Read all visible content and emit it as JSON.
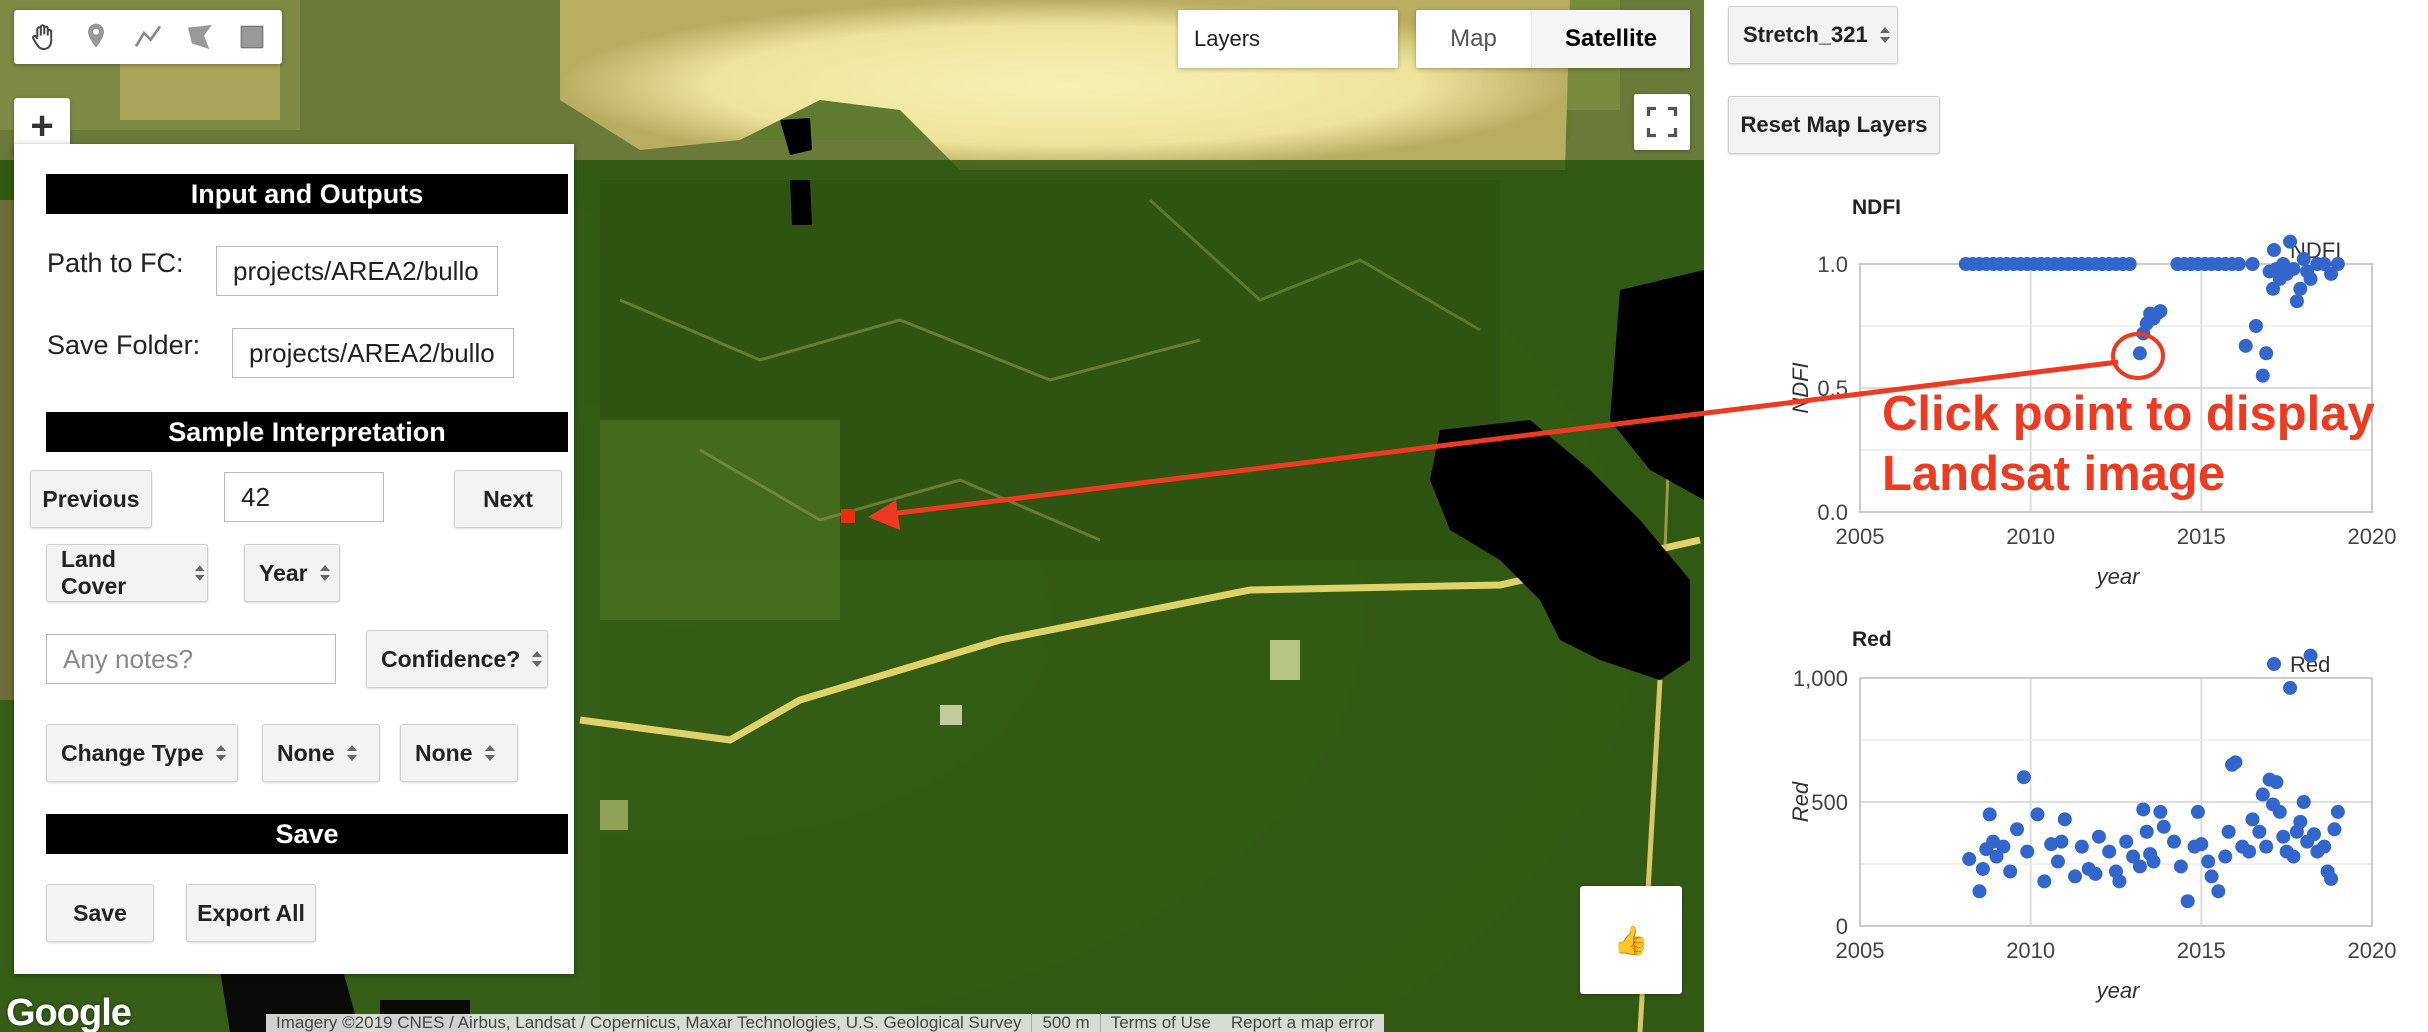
{
  "map": {
    "layers_label": "Layers",
    "map_type": {
      "map_label": "Map",
      "satellite_label": "Satellite",
      "selected": "Satellite"
    },
    "zoom_plus_label": "+",
    "google_logo": "Google",
    "attribution": "Imagery ©2019 CNES / Airbus, Landsat / Copernicus, Maxar Technologies, U.S. Geological Survey",
    "scale_label": "500 m",
    "terms_label": "Terms of Use",
    "report_label": "Report a map error",
    "thumb_icon": "👍",
    "toolbar_icons": [
      "hand-icon",
      "marker-icon",
      "line-icon",
      "polygon-icon",
      "rectangle-icon"
    ]
  },
  "panel": {
    "io_header": "Input and Outputs",
    "path_label": "Path to FC:",
    "path_value": "projects/AREA2/bullo",
    "folder_label": "Save Folder:",
    "folder_value": "projects/AREA2/bullo",
    "sample_header": "Sample Interpretation",
    "previous_label": "Previous",
    "sample_index": "42",
    "next_label": "Next",
    "land_cover_label": "Land Cover",
    "year_label": "Year",
    "notes_placeholder": "Any notes?",
    "confidence_label": "Confidence?",
    "change_type_label": "Change Type",
    "none1_label": "None",
    "none2_label": "None",
    "save_header": "Save",
    "save_label": "Save",
    "export_label": "Export All"
  },
  "sidebar": {
    "stretch_label": "Stretch_321",
    "reset_label": "Reset Map Layers"
  },
  "annotation": {
    "line1": "Click point to display",
    "line2": "Landsat image",
    "color": "#ee3a20"
  },
  "chart_data": [
    {
      "type": "scatter",
      "title": "NDFI",
      "xlabel": "year",
      "ylabel": "NDFI",
      "legend": "NDFI",
      "legend_position": "top-right",
      "xlim": [
        2005,
        2020
      ],
      "ylim": [
        0,
        1
      ],
      "xticks": [
        "2005",
        "2010",
        "2015",
        "2020"
      ],
      "yticks": [
        "0.0",
        "0.5",
        "1.0"
      ],
      "color": "#3366cc",
      "grid": true,
      "points": [
        [
          2008.1,
          1.0
        ],
        [
          2008.3,
          1.0
        ],
        [
          2008.5,
          1.0
        ],
        [
          2008.7,
          1.0
        ],
        [
          2008.9,
          1.0
        ],
        [
          2009.1,
          1.0
        ],
        [
          2009.3,
          1.0
        ],
        [
          2009.5,
          1.0
        ],
        [
          2009.7,
          1.0
        ],
        [
          2009.9,
          1.0
        ],
        [
          2010.1,
          1.0
        ],
        [
          2010.3,
          1.0
        ],
        [
          2010.5,
          1.0
        ],
        [
          2010.7,
          1.0
        ],
        [
          2010.9,
          1.0
        ],
        [
          2011.1,
          1.0
        ],
        [
          2011.3,
          1.0
        ],
        [
          2011.5,
          1.0
        ],
        [
          2011.7,
          1.0
        ],
        [
          2011.9,
          1.0
        ],
        [
          2012.1,
          1.0
        ],
        [
          2012.3,
          1.0
        ],
        [
          2012.5,
          1.0
        ],
        [
          2012.7,
          1.0
        ],
        [
          2012.9,
          1.0
        ],
        [
          2013.2,
          0.64
        ],
        [
          2013.3,
          0.72
        ],
        [
          2013.4,
          0.76
        ],
        [
          2013.5,
          0.8
        ],
        [
          2013.6,
          0.78
        ],
        [
          2013.7,
          0.8
        ],
        [
          2013.8,
          0.81
        ],
        [
          2014.3,
          1.0
        ],
        [
          2014.5,
          1.0
        ],
        [
          2014.7,
          1.0
        ],
        [
          2014.9,
          1.0
        ],
        [
          2015.1,
          1.0
        ],
        [
          2015.3,
          1.0
        ],
        [
          2015.5,
          1.0
        ],
        [
          2015.7,
          1.0
        ],
        [
          2015.9,
          1.0
        ],
        [
          2016.1,
          1.0
        ],
        [
          2016.3,
          0.67
        ],
        [
          2016.5,
          1.0
        ],
        [
          2016.6,
          0.75
        ],
        [
          2016.8,
          0.55
        ],
        [
          2016.9,
          0.64
        ],
        [
          2017.0,
          0.97
        ],
        [
          2017.1,
          0.9
        ],
        [
          2017.2,
          0.98
        ],
        [
          2017.3,
          0.94
        ],
        [
          2017.4,
          1.0
        ],
        [
          2017.5,
          0.96
        ],
        [
          2017.6,
          1.09
        ],
        [
          2017.7,
          0.98
        ],
        [
          2017.8,
          0.85
        ],
        [
          2017.9,
          0.9
        ],
        [
          2018.0,
          1.02
        ],
        [
          2018.1,
          0.97
        ],
        [
          2018.2,
          0.94
        ],
        [
          2018.4,
          1.0
        ],
        [
          2018.6,
          1.0
        ],
        [
          2018.8,
          0.96
        ],
        [
          2019.0,
          1.0
        ]
      ],
      "highlight": [
        2013.2,
        0.64
      ]
    },
    {
      "type": "scatter",
      "title": "Red",
      "xlabel": "year",
      "ylabel": "Red",
      "legend": "Red",
      "legend_position": "top-right",
      "xlim": [
        2005,
        2020
      ],
      "ylim": [
        0,
        1000
      ],
      "xticks": [
        "2005",
        "2010",
        "2015",
        "2020"
      ],
      "yticks": [
        "0",
        "500",
        "1,000"
      ],
      "color": "#3366cc",
      "grid": true,
      "points": [
        [
          2008.2,
          270
        ],
        [
          2008.5,
          140
        ],
        [
          2008.6,
          230
        ],
        [
          2008.7,
          310
        ],
        [
          2008.8,
          450
        ],
        [
          2008.9,
          340
        ],
        [
          2009.0,
          280
        ],
        [
          2009.2,
          320
        ],
        [
          2009.4,
          220
        ],
        [
          2009.6,
          390
        ],
        [
          2009.8,
          600
        ],
        [
          2009.9,
          300
        ],
        [
          2010.2,
          450
        ],
        [
          2010.4,
          180
        ],
        [
          2010.6,
          330
        ],
        [
          2010.8,
          260
        ],
        [
          2010.9,
          340
        ],
        [
          2011.0,
          430
        ],
        [
          2011.3,
          200
        ],
        [
          2011.5,
          320
        ],
        [
          2011.7,
          230
        ],
        [
          2011.9,
          210
        ],
        [
          2012.0,
          360
        ],
        [
          2012.3,
          300
        ],
        [
          2012.5,
          220
        ],
        [
          2012.6,
          180
        ],
        [
          2012.8,
          340
        ],
        [
          2013.0,
          280
        ],
        [
          2013.2,
          240
        ],
        [
          2013.3,
          470
        ],
        [
          2013.4,
          380
        ],
        [
          2013.5,
          290
        ],
        [
          2013.6,
          260
        ],
        [
          2013.8,
          460
        ],
        [
          2013.9,
          400
        ],
        [
          2014.2,
          340
        ],
        [
          2014.4,
          240
        ],
        [
          2014.6,
          100
        ],
        [
          2014.8,
          320
        ],
        [
          2014.9,
          460
        ],
        [
          2015.0,
          330
        ],
        [
          2015.2,
          260
        ],
        [
          2015.3,
          200
        ],
        [
          2015.5,
          140
        ],
        [
          2015.7,
          280
        ],
        [
          2015.8,
          380
        ],
        [
          2015.9,
          650
        ],
        [
          2016.0,
          660
        ],
        [
          2016.2,
          320
        ],
        [
          2016.4,
          300
        ],
        [
          2016.5,
          430
        ],
        [
          2016.7,
          380
        ],
        [
          2016.8,
          530
        ],
        [
          2016.9,
          320
        ],
        [
          2017.0,
          590
        ],
        [
          2017.1,
          490
        ],
        [
          2017.2,
          580
        ],
        [
          2017.3,
          460
        ],
        [
          2017.4,
          360
        ],
        [
          2017.5,
          300
        ],
        [
          2017.6,
          960
        ],
        [
          2017.7,
          280
        ],
        [
          2017.8,
          380
        ],
        [
          2017.9,
          420
        ],
        [
          2018.0,
          500
        ],
        [
          2018.1,
          340
        ],
        [
          2018.2,
          1090
        ],
        [
          2018.3,
          370
        ],
        [
          2018.4,
          300
        ],
        [
          2018.6,
          320
        ],
        [
          2018.7,
          220
        ],
        [
          2018.8,
          190
        ],
        [
          2018.9,
          390
        ],
        [
          2019.0,
          460
        ]
      ]
    }
  ]
}
